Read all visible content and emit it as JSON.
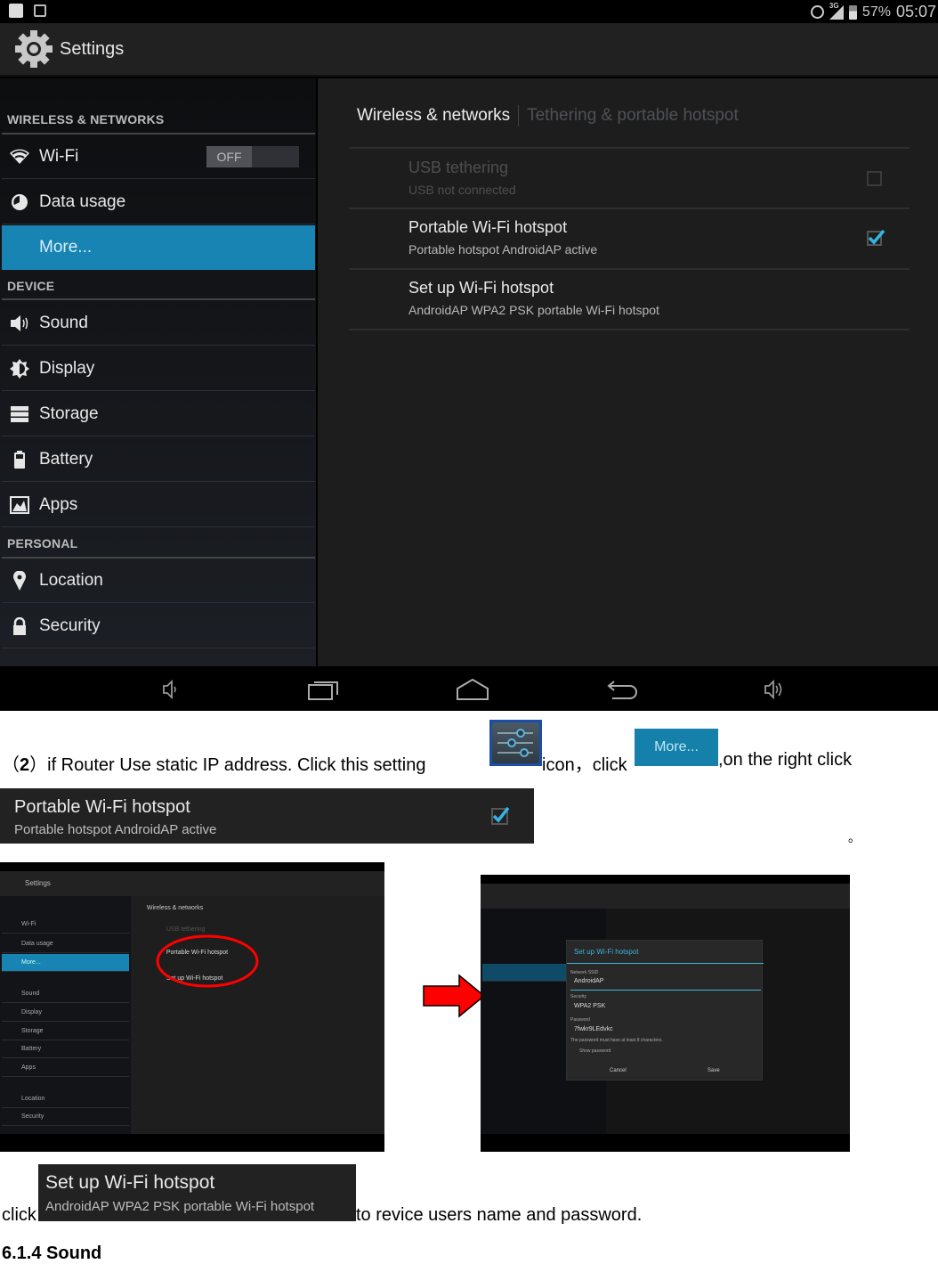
{
  "statusbar": {
    "icons_left": [
      "wifi-hotspot-icon",
      "picture-icon"
    ],
    "network": "3G",
    "battery": "57%",
    "time": "05:07"
  },
  "actionbar": {
    "title": "Settings",
    "icon": "gear-icon"
  },
  "sidebar": {
    "sections": [
      {
        "header": "WIRELESS & NETWORKS",
        "items": [
          {
            "label": "Wi-Fi",
            "icon": "wifi-icon",
            "toggle": "OFF"
          },
          {
            "label": "Data usage",
            "icon": "data-usage-icon"
          },
          {
            "label": "More...",
            "icon": "",
            "active": true
          }
        ]
      },
      {
        "header": "DEVICE",
        "items": [
          {
            "label": "Sound",
            "icon": "speaker-icon"
          },
          {
            "label": "Display",
            "icon": "brightness-icon"
          },
          {
            "label": "Storage",
            "icon": "storage-icon"
          },
          {
            "label": "Battery",
            "icon": "battery-icon"
          },
          {
            "label": "Apps",
            "icon": "apps-icon"
          }
        ]
      },
      {
        "header": "PERSONAL",
        "items": [
          {
            "label": "Location",
            "icon": "location-pin-icon"
          },
          {
            "label": "Security",
            "icon": "lock-icon"
          }
        ]
      }
    ]
  },
  "main": {
    "tabs": [
      {
        "label": "Wireless & networks",
        "active": true
      },
      {
        "label": "Tethering & portable hotspot",
        "active": false
      }
    ],
    "prefs": [
      {
        "title": "USB tethering",
        "summary": "USB not connected",
        "enabled": false,
        "checkbox": true,
        "checked": false
      },
      {
        "title": "Portable Wi-Fi hotspot",
        "summary": "Portable hotspot AndroidAP active",
        "enabled": true,
        "checkbox": true,
        "checked": true
      },
      {
        "title": "Set up Wi-Fi hotspot",
        "summary": "AndroidAP WPA2 PSK portable Wi-Fi hotspot",
        "enabled": true,
        "checkbox": false
      }
    ]
  },
  "navbar": {
    "buttons": [
      "volume-down-icon",
      "recent-apps-icon",
      "home-icon",
      "back-icon",
      "volume-up-icon"
    ]
  },
  "doc": {
    "step_prefix": "（",
    "step_number": "2",
    "step_text_1": "）if Router Use static IP address.   Click this setting",
    "step_text_2": "icon，click",
    "more_label": "More...",
    "step_text_3": ",on the right click",
    "snip1_title": "Portable Wi-Fi hotspot",
    "snip1_summary": "Portable hotspot AndroidAP active",
    "period": "。",
    "click_word": "click",
    "snip2_title": "Set up Wi-Fi hotspot",
    "snip2_summary": "AndroidAP WPA2 PSK portable Wi-Fi hotspot",
    "after_text": "to revice users name and password.",
    "section_heading": "6.1.4 Sound"
  },
  "thumb_left": {
    "title": "Settings",
    "rows": [
      "Wi-Fi",
      "Data usage",
      "More...",
      "Sound",
      "Display",
      "Storage",
      "Battery",
      "Apps",
      "Location",
      "Security"
    ],
    "tabs": "Wireless & networks",
    "pref1": "USB tethering",
    "pref2": "Portable Wi-Fi hotspot",
    "pref3": "Set up Wi-Fi hotspot",
    "annotation": "red-ellipse-highlight"
  },
  "thumb_right": {
    "dialog": {
      "title": "Set up Wi-Fi hotspot",
      "ssid_label": "Network SSID",
      "ssid_value": "AndroidAP",
      "security_label": "Security",
      "security_value": "WPA2 PSK",
      "password_label": "Password",
      "password_value": "7fwkr9LEdvkc",
      "hint": "The password must have at least 8 characters.",
      "show_password": "Show password",
      "cancel": "Cancel",
      "save": "Save"
    }
  },
  "colors": {
    "accent": "#1784b4",
    "holo_blue": "#33b5e5",
    "arrow": "#ff0000"
  }
}
